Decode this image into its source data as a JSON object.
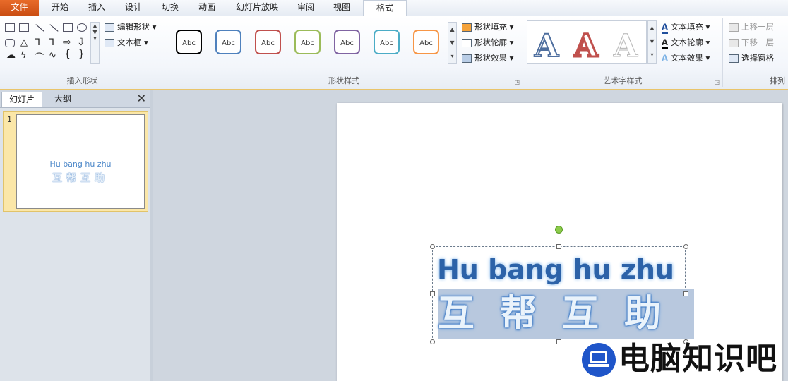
{
  "tabs": {
    "file": "文件",
    "home": "开始",
    "insert": "插入",
    "design": "设计",
    "transitions": "切换",
    "animations": "动画",
    "slideshow": "幻灯片放映",
    "review": "审阅",
    "view": "视图",
    "format": "格式"
  },
  "ribbon": {
    "insert_shapes": {
      "label": "插入形状",
      "edit_shape": "编辑形状",
      "text_box": "文本框"
    },
    "shape_styles": {
      "label": "形状样式",
      "presets": [
        "Abc",
        "Abc",
        "Abc",
        "Abc",
        "Abc",
        "Abc",
        "Abc"
      ],
      "preset_colors": [
        "#000000",
        "#4f81bd",
        "#c0504d",
        "#9bbb59",
        "#8064a2",
        "#4bacc6",
        "#f79646"
      ],
      "fill": "形状填充",
      "outline": "形状轮廓",
      "effects": "形状效果"
    },
    "wordart_styles": {
      "label": "艺术字样式",
      "samples": [
        "A",
        "A",
        "A"
      ],
      "text_fill": "文本填充",
      "text_outline": "文本轮廓",
      "text_effects": "文本效果"
    },
    "arrange": {
      "label": "排列",
      "bring_forward": "上移一层",
      "send_backward": "下移一层",
      "selection_pane": "选择窗格"
    }
  },
  "left_panel": {
    "tab_slides": "幻灯片",
    "tab_outline": "大纲",
    "close": "✕",
    "slide_number": "1",
    "thumb_line1": "Hu bang hu zhu",
    "thumb_line2": "互帮互助"
  },
  "slide": {
    "line1": "Hu bang hu zhu",
    "line2": "互帮互助"
  },
  "watermark": {
    "text": "电脑知识吧"
  },
  "colors": {
    "file_tab": "#d35a1e",
    "text_blue": "#2c62a8",
    "selection": "#b8c8de",
    "rotate_handle": "#8ccb4a"
  }
}
